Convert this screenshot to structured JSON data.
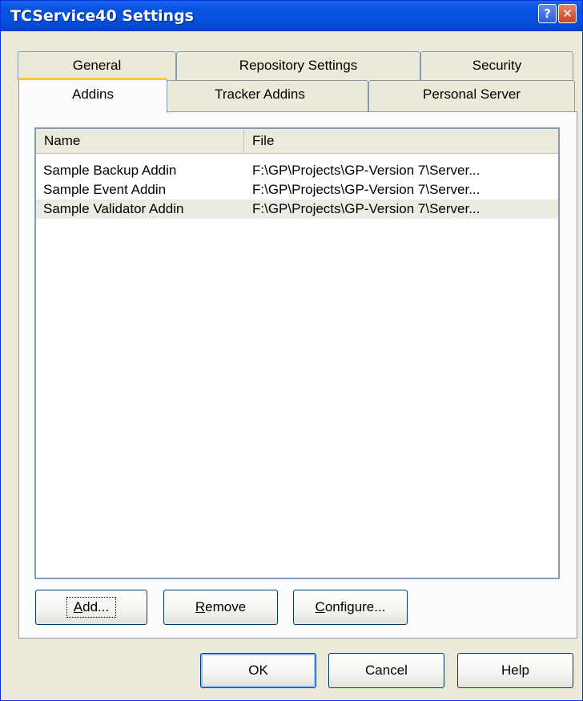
{
  "window": {
    "title": "TCService40 Settings",
    "help_glyph": "?",
    "close_glyph": "✕"
  },
  "tabs": {
    "back_row": [
      "General",
      "Repository Settings",
      "Security"
    ],
    "front_row": [
      "Addins",
      "Tracker Addins",
      "Personal Server"
    ],
    "active": "Addins"
  },
  "list": {
    "columns": [
      "Name",
      "File"
    ],
    "rows": [
      {
        "name": "Sample Backup Addin",
        "file": "F:\\GP\\Projects\\GP-Version 7\\Server..."
      },
      {
        "name": "Sample Event Addin",
        "file": "F:\\GP\\Projects\\GP-Version 7\\Server..."
      },
      {
        "name": "Sample Validator Addin",
        "file": "F:\\GP\\Projects\\GP-Version 7\\Server..."
      }
    ],
    "selected_index": 2
  },
  "panel_buttons": {
    "add": {
      "mn": "A",
      "rest": "dd..."
    },
    "remove": {
      "mn": "R",
      "rest": "emove"
    },
    "configure": {
      "mn": "C",
      "rest": "onfigure..."
    }
  },
  "dialog_buttons": {
    "ok": "OK",
    "cancel": "Cancel",
    "help": "Help"
  },
  "colors": {
    "titlebar": "#0552e3",
    "face": "#ece9d8",
    "active_tab_accent": "#ffc83c"
  }
}
